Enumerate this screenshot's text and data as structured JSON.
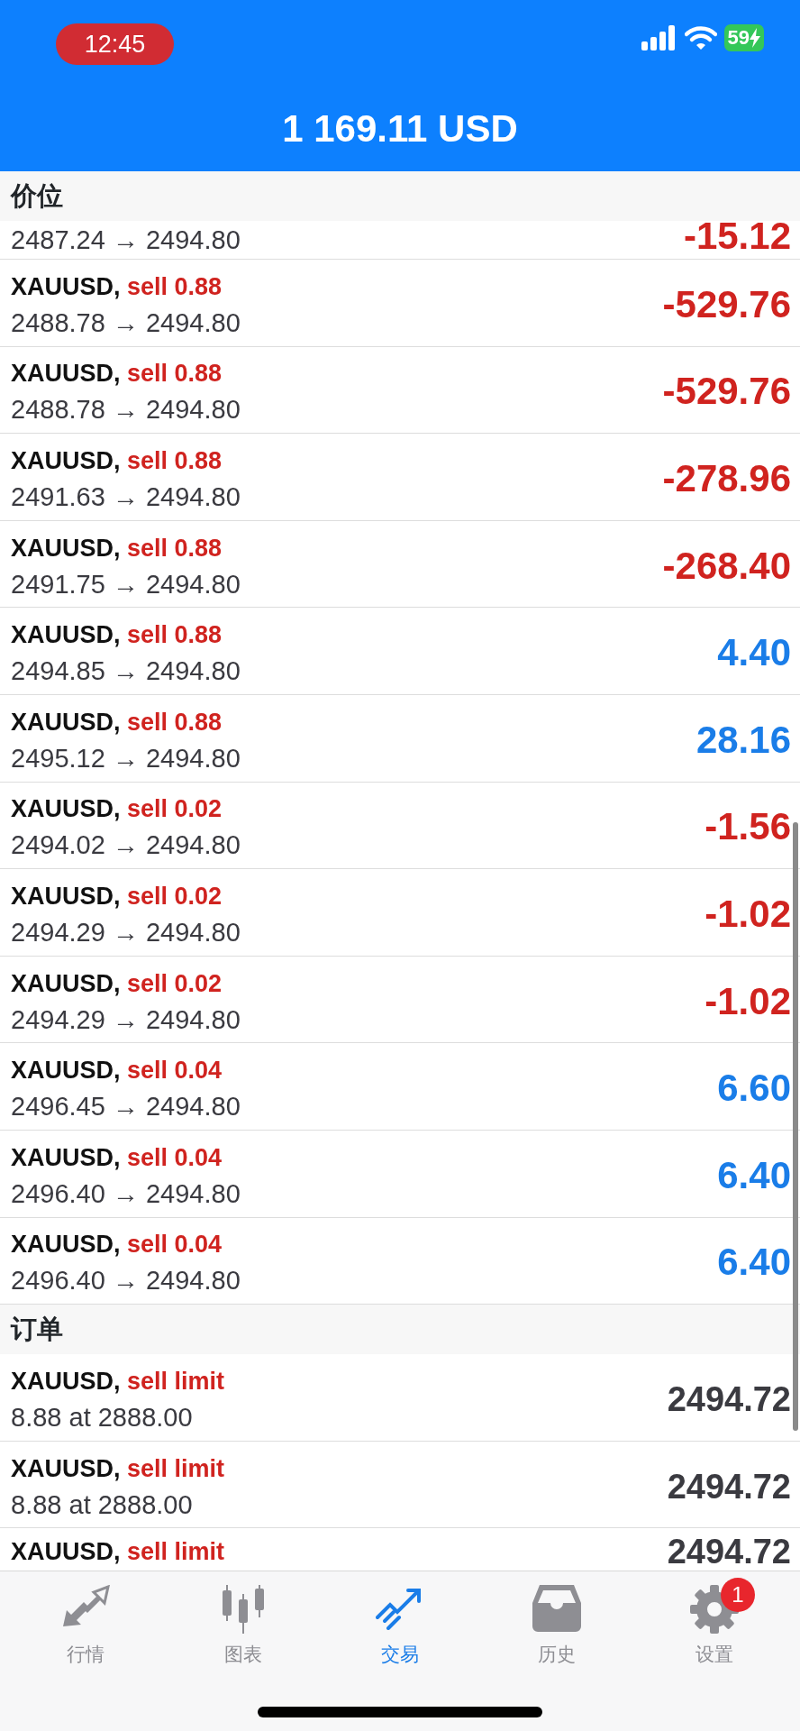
{
  "status_bar": {
    "time": "12:45",
    "battery": "59"
  },
  "header": {
    "balance": "1 169.11 USD"
  },
  "sections": [
    {
      "title": "价位",
      "rows": [
        {
          "detail": "2487.24 → 2494.80",
          "value": "-15.12",
          "color": "#d0231f"
        },
        {
          "symbol": "XAUUSD,",
          "type": "sell 0.88",
          "detail": "2488.78 → 2494.80",
          "value": "-529.76",
          "color": "#d0231f"
        },
        {
          "symbol": "XAUUSD,",
          "type": "sell 0.88",
          "detail": "2488.78 → 2494.80",
          "value": "-529.76",
          "color": "#d0231f"
        },
        {
          "symbol": "XAUUSD,",
          "type": "sell 0.88",
          "detail": "2491.63 → 2494.80",
          "value": "-278.96",
          "color": "#d0231f"
        },
        {
          "symbol": "XAUUSD,",
          "type": "sell 0.88",
          "detail": "2491.75 → 2494.80",
          "value": "-268.40",
          "color": "#d0231f"
        },
        {
          "symbol": "XAUUSD,",
          "type": "sell 0.88",
          "detail": "2494.85 → 2494.80",
          "value": "4.40",
          "color": "#1a7de8"
        },
        {
          "symbol": "XAUUSD,",
          "type": "sell 0.88",
          "detail": "2495.12 → 2494.80",
          "value": "28.16",
          "color": "#1a7de8"
        },
        {
          "symbol": "XAUUSD,",
          "type": "sell 0.02",
          "detail": "2494.02 → 2494.80",
          "value": "-1.56",
          "color": "#d0231f"
        },
        {
          "symbol": "XAUUSD,",
          "type": "sell 0.02",
          "detail": "2494.29 → 2494.80",
          "value": "-1.02",
          "color": "#d0231f"
        },
        {
          "symbol": "XAUUSD,",
          "type": "sell 0.02",
          "detail": "2494.29 → 2494.80",
          "value": "-1.02",
          "color": "#d0231f"
        },
        {
          "symbol": "XAUUSD,",
          "type": "sell 0.04",
          "detail": "2496.45 → 2494.80",
          "value": "6.60",
          "color": "#1a7de8"
        },
        {
          "symbol": "XAUUSD,",
          "type": "sell 0.04",
          "detail": "2496.40 → 2494.80",
          "value": "6.40",
          "color": "#1a7de8"
        },
        {
          "symbol": "XAUUSD,",
          "type": "sell 0.04",
          "detail": "2496.40 → 2494.80",
          "value": "6.40",
          "color": "#1a7de8"
        }
      ]
    },
    {
      "title": "订单",
      "rows": [
        {
          "symbol": "XAUUSD,",
          "type": "sell limit",
          "detail": "8.88 at 2888.00",
          "value": "2494.72",
          "color": "#3a3a40"
        },
        {
          "symbol": "XAUUSD,",
          "type": "sell limit",
          "detail": "8.88 at 2888.00",
          "value": "2494.72",
          "color": "#3a3a40"
        },
        {
          "symbol": "XAUUSD,",
          "type": "sell limit",
          "value": "2494.72",
          "color": "#3a3a40"
        }
      ]
    }
  ],
  "tabs": [
    {
      "label": "行情",
      "selected": false
    },
    {
      "label": "图表",
      "selected": false
    },
    {
      "label": "交易",
      "selected": true
    },
    {
      "label": "历史",
      "selected": false
    },
    {
      "label": "设置",
      "selected": false,
      "badge": "1"
    }
  ]
}
